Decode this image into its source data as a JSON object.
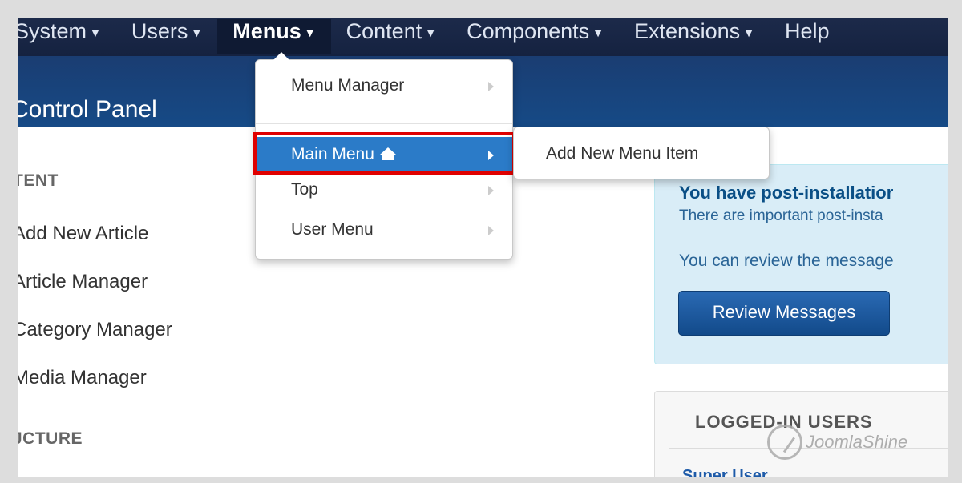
{
  "navbar": {
    "items": [
      {
        "label": "System"
      },
      {
        "label": "Users"
      },
      {
        "label": "Menus"
      },
      {
        "label": "Content"
      },
      {
        "label": "Components"
      },
      {
        "label": "Extensions"
      },
      {
        "label": "Help"
      }
    ],
    "active": "Menus"
  },
  "header": {
    "title": "Control Panel"
  },
  "sidebar": {
    "content_heading": "TENT",
    "links": [
      {
        "label": "Add New Article"
      },
      {
        "label": "Article Manager"
      },
      {
        "label": "Category Manager"
      },
      {
        "label": "Media Manager"
      }
    ],
    "structure_heading": "JCTURE"
  },
  "dropdown": {
    "items": [
      {
        "label": "Menu Manager"
      },
      {
        "label": "Main Menu"
      },
      {
        "label": "Top"
      },
      {
        "label": "User Menu"
      }
    ],
    "active_item": "Main Menu",
    "active_icon": "home-icon"
  },
  "submenu": {
    "items": [
      {
        "label": "Add New Menu Item"
      }
    ]
  },
  "alert": {
    "title": "You have post-installatior",
    "line1": "There are important post-insta",
    "line2": "You can review the message",
    "button": "Review Messages"
  },
  "users_panel": {
    "title": "LOGGED-IN USERS",
    "first_user": "Super User"
  },
  "watermark": {
    "text": "JoomlaShine"
  },
  "colors": {
    "navbar": "#152240",
    "header": "#164a86",
    "active_menu_item": "#2b7bc8",
    "highlight_border": "#e00000",
    "alert_bg": "#d9edf7"
  }
}
